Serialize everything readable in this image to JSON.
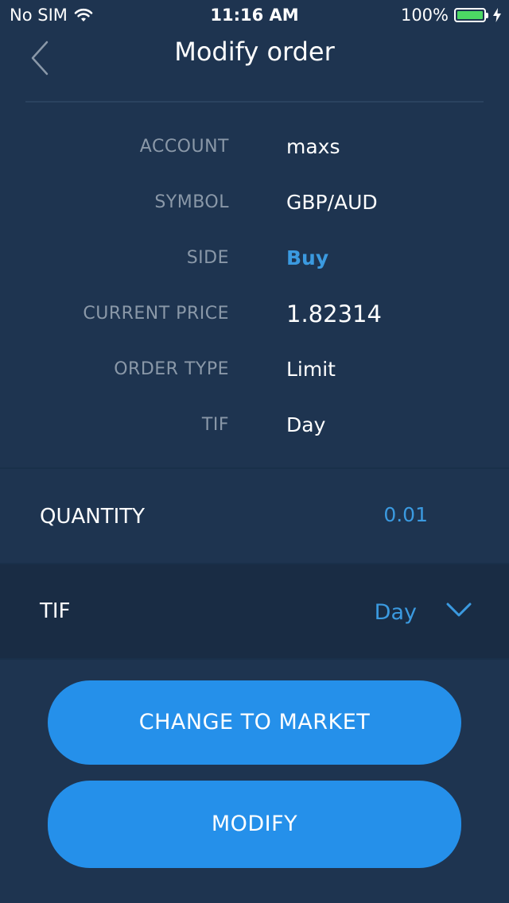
{
  "status_bar": {
    "carrier": "No SIM",
    "time": "11:16 AM",
    "battery": "100%"
  },
  "nav": {
    "title": "Modify order"
  },
  "details": [
    {
      "label": "ACCOUNT",
      "value": "maxs"
    },
    {
      "label": "SYMBOL",
      "value": "GBP/AUD"
    },
    {
      "label": "SIDE",
      "value": "Buy"
    },
    {
      "label": "CURRENT PRICE",
      "value": "1.82314"
    },
    {
      "label": "ORDER TYPE",
      "value": "Limit"
    },
    {
      "label": "TIF",
      "value": "Day"
    }
  ],
  "quantity": {
    "label": "QUANTITY",
    "value": "0.01"
  },
  "tif": {
    "label": "TIF",
    "value": "Day"
  },
  "buttons": {
    "change_to_market": "CHANGE TO MARKET",
    "modify": "MODIFY"
  },
  "colors": {
    "background": "#1e3450",
    "accent": "#3b9ae0",
    "button": "#2590ea",
    "battery": "#4cd964"
  }
}
